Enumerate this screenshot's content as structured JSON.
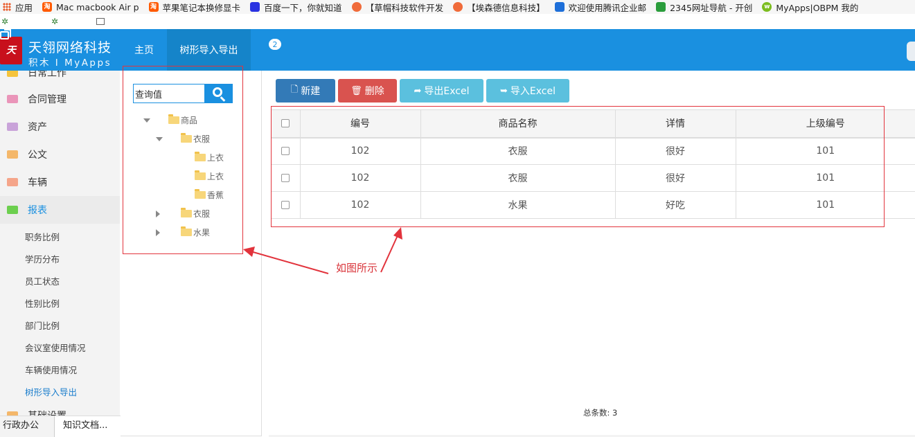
{
  "bookmarks": [
    {
      "label": "应用",
      "icon": "apps-icon"
    },
    {
      "label": "Mac macbook Air p",
      "icon": "taobao-icon"
    },
    {
      "label": "苹果笔记本换修显卡",
      "icon": "taobao-icon"
    },
    {
      "label": "百度一下，你就知道",
      "icon": "baidu-icon"
    },
    {
      "label": "【草帽科技软件开发",
      "icon": "site-icon"
    },
    {
      "label": "【埃森德信息科技】",
      "icon": "site-icon"
    },
    {
      "label": "欢迎使用腾讯企业邮",
      "icon": "qqmail-icon"
    },
    {
      "label": "2345网址导航 - 开创",
      "icon": "nav2345-icon"
    },
    {
      "label": "MyApps|OBPM 我的",
      "icon": "myapps-icon"
    }
  ],
  "header": {
    "brand": "天翎网络科技",
    "brand_sub": "积木 I MyApps",
    "nav_home": "主页",
    "nav_current": "树形导入导出",
    "tab_count": "2",
    "colors": {
      "primary": "#1a90e0",
      "active_nav": "#1584c9"
    }
  },
  "sidebar": {
    "items": [
      {
        "label": "日常工作",
        "icon": "daily-work-icon"
      },
      {
        "label": "合同管理",
        "icon": "contract-icon"
      },
      {
        "label": "资产",
        "icon": "assets-icon"
      },
      {
        "label": "公文",
        "icon": "document-icon"
      },
      {
        "label": "车辆",
        "icon": "vehicle-icon"
      },
      {
        "label": "报表",
        "icon": "report-icon"
      }
    ],
    "submenu": [
      "职务比例",
      "学历分布",
      "员工状态",
      "性别比例",
      "部门比例",
      "会议室使用情况",
      "车辆使用情况",
      "树形导入导出"
    ],
    "next_group": "基础设置",
    "bottom_tabs": [
      "行政办公",
      "知识文档..."
    ]
  },
  "tree": {
    "search_placeholder": "查询值",
    "nodes": [
      {
        "label": "商品"
      },
      {
        "label": "衣服"
      },
      {
        "label": "上衣"
      },
      {
        "label": "上衣"
      },
      {
        "label": "香蕉"
      },
      {
        "label": "衣服"
      },
      {
        "label": "水果"
      }
    ]
  },
  "toolbar": {
    "new_label": "新建",
    "delete_label": "删除",
    "export_label": "导出Excel",
    "import_label": "导入Excel"
  },
  "table": {
    "headers": [
      "编号",
      "商品名称",
      "详情",
      "上级编号"
    ],
    "rows": [
      [
        "102",
        "衣服",
        "很好",
        "101"
      ],
      [
        "102",
        "衣服",
        "很好",
        "101"
      ],
      [
        "102",
        "水果",
        "好吃",
        "101"
      ]
    ],
    "total": "总条数: 3"
  },
  "annotation": {
    "text": "如图所示",
    "color": "#e2333c"
  }
}
